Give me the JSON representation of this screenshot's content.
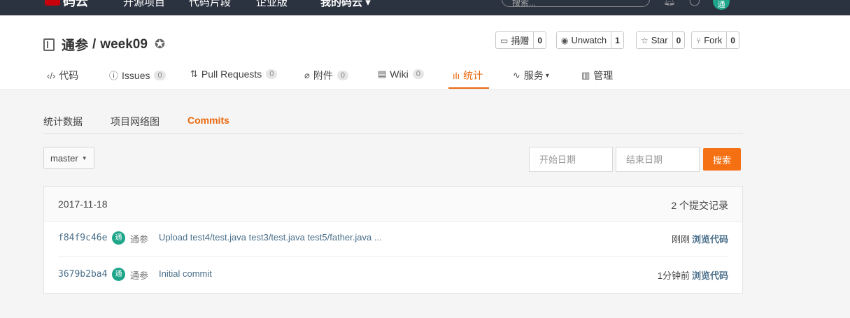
{
  "topbar": {
    "logo_text": "码云",
    "nav": [
      "开源项目",
      "代码片段",
      "企业版",
      "我的码云"
    ],
    "search_placeholder": "搜索...",
    "avatar_text": "通"
  },
  "repo": {
    "owner": "通参",
    "separator": "/",
    "name": "week09",
    "actions": [
      {
        "label": "捐赠",
        "count": "0"
      },
      {
        "label": "Unwatch",
        "count": "1"
      },
      {
        "label": "Star",
        "count": "0"
      },
      {
        "label": "Fork",
        "count": "0"
      }
    ]
  },
  "tabs": [
    {
      "label": "代码"
    },
    {
      "label": "Issues",
      "badge": "0"
    },
    {
      "label": "Pull Requests",
      "badge": "0"
    },
    {
      "label": "附件",
      "badge": "0"
    },
    {
      "label": "Wiki",
      "badge": "0"
    },
    {
      "label": "统计"
    },
    {
      "label": "服务"
    },
    {
      "label": "管理"
    }
  ],
  "subtabs": [
    "统计数据",
    "项目网络图",
    "Commits"
  ],
  "filter": {
    "branch": "master",
    "start_placeholder": "开始日期",
    "end_placeholder": "结束日期",
    "search_label": "搜索"
  },
  "commits": {
    "date": "2017-11-18",
    "count_text": "2 个提交记录",
    "rows": [
      {
        "sha": "f84f9c46e",
        "avatar": "通",
        "author": "通参",
        "message": "Upload test4/test.java test3/test.java test5/father.java ...",
        "time": "刚刚",
        "browse": "浏览代码"
      },
      {
        "sha": "3679b2ba4",
        "avatar": "通",
        "author": "通参",
        "message": "Initial commit",
        "time": "1分钟前",
        "browse": "浏览代码"
      }
    ]
  },
  "colors": {
    "accent": "#e8680c",
    "button": "#f57013",
    "topbar": "#2b3240",
    "avatar": "#1ea58a"
  }
}
